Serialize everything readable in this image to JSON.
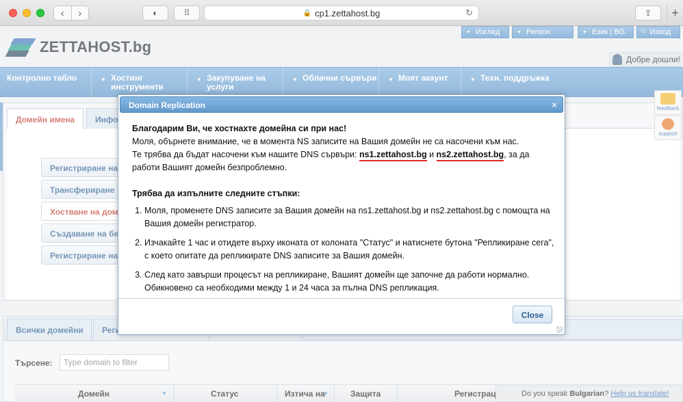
{
  "browser": {
    "url": "cp1.zettahost.bg"
  },
  "site": {
    "logo_text": "ZETTAHOST.bg",
    "top_menu": [
      {
        "label": "Изглед"
      },
      {
        "label": "Регион"
      },
      {
        "label": "Език | BG"
      },
      {
        "label": "Изход"
      }
    ],
    "welcome": "Добре дошли!",
    "main_nav": [
      {
        "label": "Контролно табло",
        "has_arrow": false
      },
      {
        "label": "Хостинг инструменти",
        "has_arrow": true
      },
      {
        "label": "Закупуване на услуги",
        "has_arrow": true
      },
      {
        "label": "Облачни сървъри",
        "has_arrow": true
      },
      {
        "label": "Моят акаунт",
        "has_arrow": true
      },
      {
        "label": "Техн. поддръжка",
        "has_arrow": true
      }
    ],
    "tabs": [
      {
        "label": "Домейн имена",
        "active": true
      },
      {
        "label": "Инфо",
        "active": false
      }
    ],
    "domain_actions": [
      {
        "label": "Регистриране на"
      },
      {
        "label": "Трансфериране"
      },
      {
        "label": "Хостване на дом"
      },
      {
        "label": "Създаване на бе"
      },
      {
        "label": "Регистриране на"
      }
    ],
    "list_tabs": [
      {
        "label": "Всички домейни"
      },
      {
        "label": "Регис"
      }
    ],
    "search": {
      "label": "Търсене:",
      "placeholder": "Type domain to filter"
    },
    "table_headers": [
      "Домейн",
      "Статус",
      "Изтича на",
      "Защита",
      "Регистрац"
    ],
    "translate": {
      "prefix": "Do you speak ",
      "language": "Bulgarian",
      "suffix": "? ",
      "link": "Help us translate!"
    },
    "widgets": [
      {
        "label": "feedback",
        "icon": "star-icon",
        "color": "#f0b429"
      },
      {
        "label": "support",
        "icon": "lifebuoy-icon",
        "color": "#e8792b"
      }
    ]
  },
  "dialog": {
    "title": "Domain Replication",
    "close_symbol": "×",
    "intro": "Благодарим Ви, че хостнахте домейна си при нас!",
    "notice": "Моля, обърнете внимание, че в момента NS записите на Вашия домейн не са насочени към нас.",
    "ns_text_before": "Те трябва да бъдат насочени към нашите DNS сървъри: ",
    "ns1": "ns1.zettahost.bg",
    "ns_and": " и ",
    "ns2": "ns2.zettahost.bg",
    "ns_text_after": ", за да работи Вашият домейн безпроблемно.",
    "steps_title": "Трябва да изпълните следните стъпки:",
    "steps": [
      "Моля, променете DNS записите за Вашия домейн на ns1.zettahost.bg и ns2.zettahost.bg с помощта на Вашия домейн регистратор.",
      "Изчакайте 1 час и отидете върху иконата от колоната \"Статус\" и натиснете бутона \"Репликиране сега\", с което опитате да репликирате DNS записите за Вашия домейн.",
      "След като завърши процесът на репликиране, Вашият домейн ще започне да работи нормално. Обикновено са необходими между 1 и 24 часа за пълна DNS репликация."
    ],
    "close_label": "Close"
  }
}
